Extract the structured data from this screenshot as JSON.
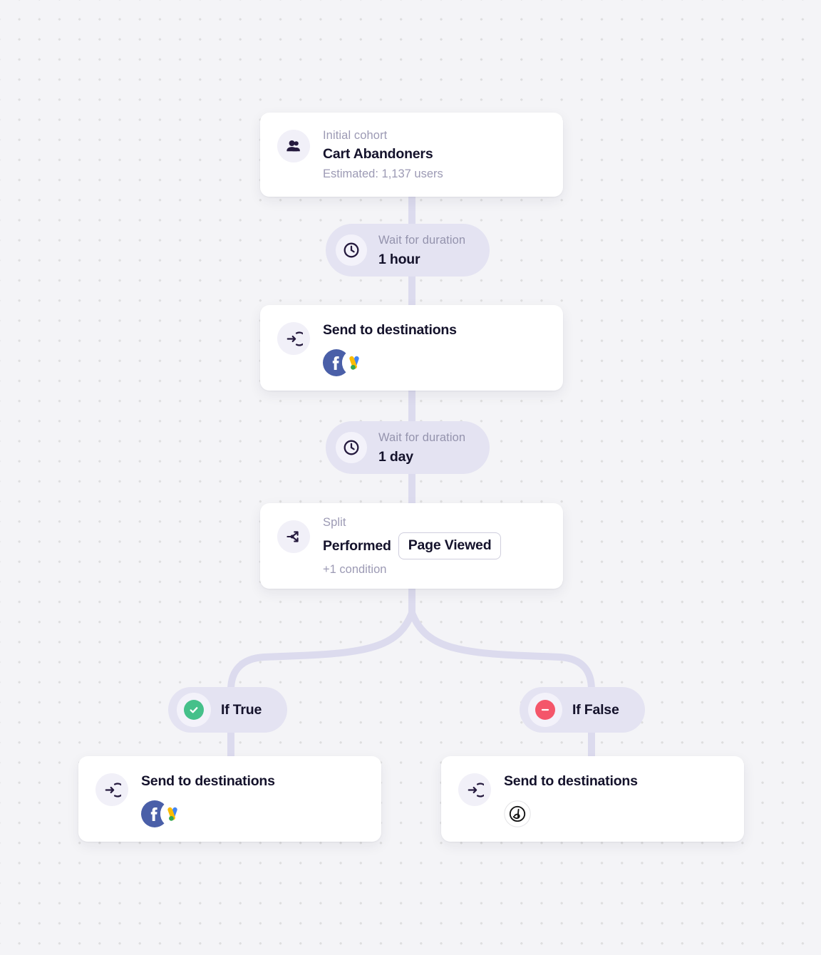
{
  "canvas": {
    "background_color": "#f4f4f7",
    "dot_color": "#dededf",
    "connector_color": "#dcdbee"
  },
  "nodes": {
    "cohort": {
      "icon": "users-icon",
      "eyebrow": "Initial cohort",
      "title": "Cart Abandoners",
      "subnote": "Estimated: 1,137 users"
    },
    "wait_hour": {
      "icon": "clock-icon",
      "eyebrow": "Wait for duration",
      "title": "1 hour"
    },
    "send_top": {
      "icon": "send-arrow-icon",
      "title": "Send to destinations",
      "destinations": [
        "facebook",
        "google-ads"
      ]
    },
    "wait_day": {
      "icon": "clock-icon",
      "eyebrow": "Wait for duration",
      "title": "1 day"
    },
    "split": {
      "icon": "split-branch-icon",
      "eyebrow": "Split",
      "title": "Performed",
      "chip": "Page Viewed",
      "subnote": "+1 condition"
    },
    "branch_true": {
      "icon": "check-circle-icon",
      "label": "If True",
      "color": "#45c08a"
    },
    "branch_false": {
      "icon": "minus-circle-icon",
      "label": "If False",
      "color": "#f4566a"
    },
    "send_true": {
      "icon": "send-arrow-icon",
      "title": "Send to destinations",
      "destinations": [
        "facebook",
        "google-ads"
      ]
    },
    "send_false": {
      "icon": "send-arrow-icon",
      "title": "Send to destinations",
      "destinations": [
        "braze"
      ]
    }
  }
}
